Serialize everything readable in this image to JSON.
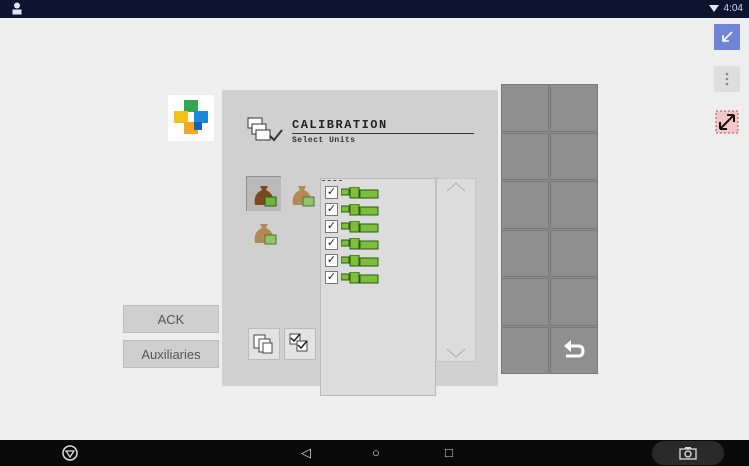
{
  "status_bar": {
    "time": "4:04",
    "wifi_icon": "wifi-icon",
    "user_icon": "user-icon"
  },
  "calibration": {
    "title": "CALIBRATION",
    "subtitle": "Select Units",
    "units": [
      {
        "checked": true,
        "icon": "meter-unit-icon"
      },
      {
        "checked": true,
        "icon": "meter-unit-icon"
      },
      {
        "checked": true,
        "icon": "meter-unit-icon"
      },
      {
        "checked": true,
        "icon": "meter-unit-icon"
      },
      {
        "checked": true,
        "icon": "meter-unit-icon"
      },
      {
        "checked": true,
        "icon": "meter-unit-icon"
      }
    ],
    "check_mark": "✓"
  },
  "side_buttons": {
    "ack_label": "ACK",
    "aux_label": "Auxiliaries"
  },
  "softkeys": {
    "return_icon": "return-icon"
  },
  "nav": {
    "back": "◁",
    "home": "○",
    "recents": "□"
  },
  "colors": {
    "accent": "#6f86d6",
    "status_bar": "#0d1530",
    "panel": "#d0d0d0",
    "softkey": "#8f8f8f"
  }
}
